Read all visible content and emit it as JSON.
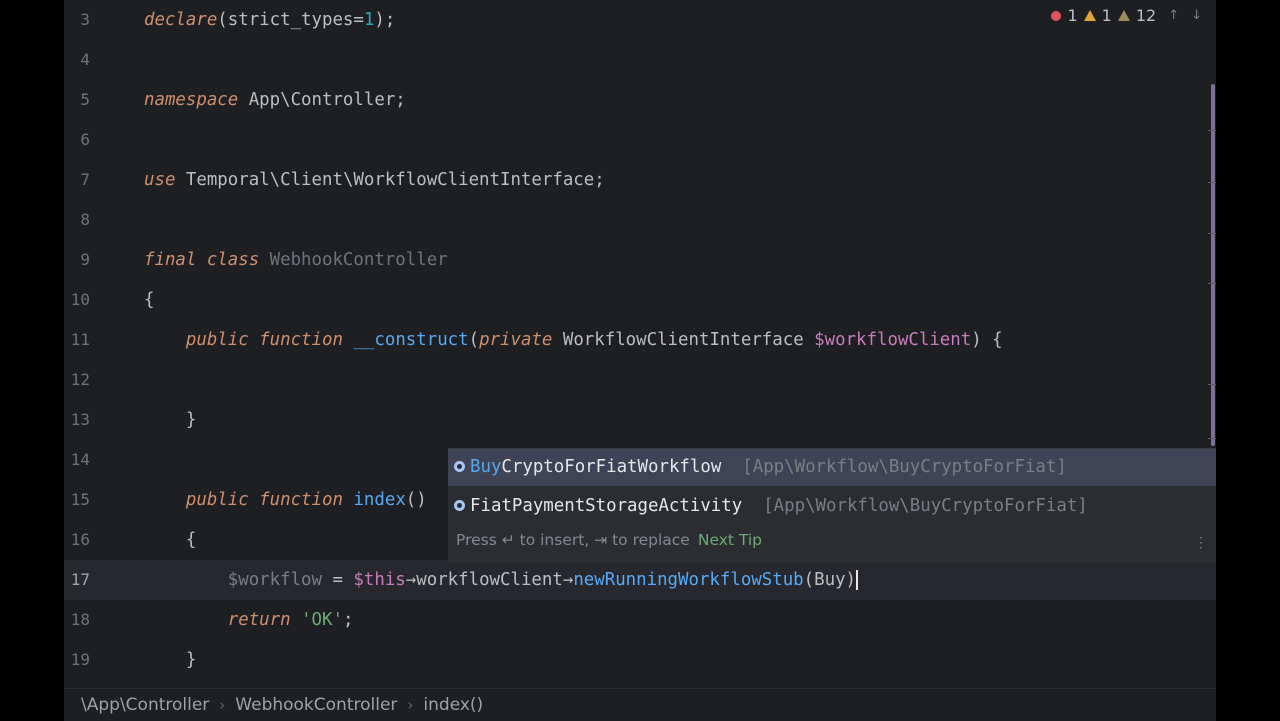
{
  "inspection": {
    "errors": "1",
    "warnings": "1",
    "weak_warnings": "12",
    "up_arrow": "↑",
    "down_arrow": "↓"
  },
  "code_lines": [
    {
      "n": "3",
      "tokens": [
        [
          "kw",
          "declare"
        ],
        [
          "",
          "(strict_types="
        ],
        [
          "num",
          "1"
        ],
        [
          "",
          ");"
        ]
      ]
    },
    {
      "n": "4",
      "tokens": []
    },
    {
      "n": "5",
      "tokens": [
        [
          "kw",
          "namespace"
        ],
        [
          "",
          " App\\Controller;"
        ]
      ]
    },
    {
      "n": "6",
      "tokens": []
    },
    {
      "n": "7",
      "tokens": [
        [
          "kw",
          "use"
        ],
        [
          "",
          " Temporal\\Client\\WorkflowClientInterface;"
        ]
      ]
    },
    {
      "n": "8",
      "tokens": []
    },
    {
      "n": "9",
      "tokens": [
        [
          "kw",
          "final class"
        ],
        [
          "cls",
          " WebhookController"
        ]
      ]
    },
    {
      "n": "10",
      "tokens": [
        [
          "",
          "{"
        ]
      ]
    },
    {
      "n": "11",
      "tokens": [
        [
          "",
          "    "
        ],
        [
          "kw",
          "public function"
        ],
        [
          "",
          " "
        ],
        [
          "fn",
          "__construct"
        ],
        [
          "",
          "("
        ],
        [
          "kw",
          "private"
        ],
        [
          "",
          " WorkflowClientInterface "
        ],
        [
          "vr",
          "$workflowClient"
        ],
        [
          "",
          ") {"
        ]
      ]
    },
    {
      "n": "12",
      "tokens": []
    },
    {
      "n": "13",
      "tokens": [
        [
          "",
          "    }"
        ]
      ]
    },
    {
      "n": "14",
      "tokens": []
    },
    {
      "n": "15",
      "tokens": [
        [
          "",
          "    "
        ],
        [
          "kw",
          "public function"
        ],
        [
          "",
          " "
        ],
        [
          "fn",
          "index"
        ],
        [
          "",
          "()"
        ]
      ]
    },
    {
      "n": "16",
      "tokens": [
        [
          "",
          "    {"
        ]
      ]
    },
    {
      "n": "17",
      "tokens": [
        [
          "",
          "        "
        ],
        [
          "dim",
          "$workflow"
        ],
        [
          "",
          " = "
        ],
        [
          "vr",
          "$this"
        ],
        [
          "",
          "→workflowClient→"
        ],
        [
          "fn2",
          "newRunningWorkflowStub"
        ],
        [
          "",
          "(Buy)"
        ]
      ]
    },
    {
      "n": "18",
      "tokens": [
        [
          "",
          "        "
        ],
        [
          "kw",
          "return"
        ],
        [
          "",
          " "
        ],
        [
          "str",
          "'OK'"
        ],
        [
          "",
          ";"
        ]
      ]
    },
    {
      "n": "19",
      "tokens": [
        [
          "",
          "    }"
        ]
      ]
    }
  ],
  "completion": {
    "items": [
      {
        "match": "Buy",
        "rest": "CryptoForFiatWorkflow",
        "pkg": "[App\\Workflow\\BuyCryptoForFiat]",
        "icon": "class-icon"
      },
      {
        "match": "",
        "rest": "FiatPaymentStorageActivity",
        "pkg": "[App\\Workflow\\BuyCryptoForFiat]",
        "icon": "class-icon"
      }
    ],
    "hint": "Press ↵ to insert, ⇥ to replace",
    "next_tip": "Next Tip",
    "menu": "⋮"
  },
  "breadcrumbs": [
    "\\App\\Controller",
    "WebhookController",
    "index()"
  ],
  "colors": {
    "editor_bg": "#1e1f22",
    "keyword": "#cf8e6d",
    "function": "#56a8f5",
    "variable": "#c77dbb",
    "popup_selected": "#3e4456"
  }
}
